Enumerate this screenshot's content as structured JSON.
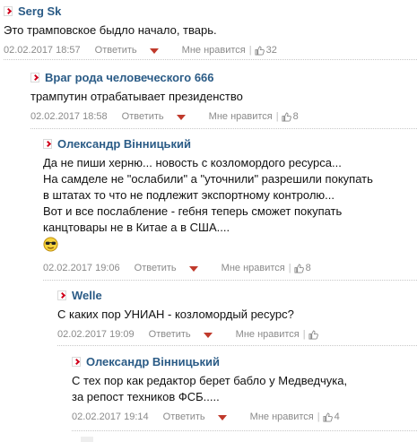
{
  "comments": [
    {
      "author": "Serg Sk",
      "lines": [
        "Это трамповское быдло начало, тварь."
      ],
      "date": "02.02.2017 18:57",
      "reply": "Ответить",
      "like": "Мне нравится",
      "likes": "32"
    },
    {
      "author": "Враг рода человеческого 666",
      "lines": [
        "трампутин отрабатывает президенство"
      ],
      "date": "02.02.2017 18:58",
      "reply": "Ответить",
      "like": "Мне нравится",
      "likes": "8"
    },
    {
      "author": "Олександр Вінницький",
      "lines": [
        "Да не пиши херню... новость с козломордого ресурса...",
        "На самделе не \"ослабили\" а \"уточнили\" разрешили покупать",
        "в штатах то что не подлежит экспортному контролю...",
        "Вот и все послабление - гебня теперь сможет покупать",
        "канцтовары не в Китае а в США...."
      ],
      "emoji": "smiley-sunglasses-icon",
      "date": "02.02.2017 19:06",
      "reply": "Ответить",
      "like": "Мне нравится",
      "likes": "8"
    },
    {
      "author": "Welle",
      "lines": [
        "С каких пор УНИАН - козломордый ресурс?"
      ],
      "date": "02.02.2017 19:09",
      "reply": "Ответить",
      "like": "Мне нравится",
      "likes": ""
    },
    {
      "author": "Олександр Вінницький",
      "lines": [
        "С тех пор как редактор берет бабло у Медведчука,",
        "за репост техников ФСБ....."
      ],
      "date": "02.02.2017 19:14",
      "reply": "Ответить",
      "like": "Мне нравится",
      "likes": "4"
    }
  ],
  "colors": {
    "author": "#2a5b86",
    "accent": "#d0021b",
    "meta": "#8a8a8a"
  }
}
